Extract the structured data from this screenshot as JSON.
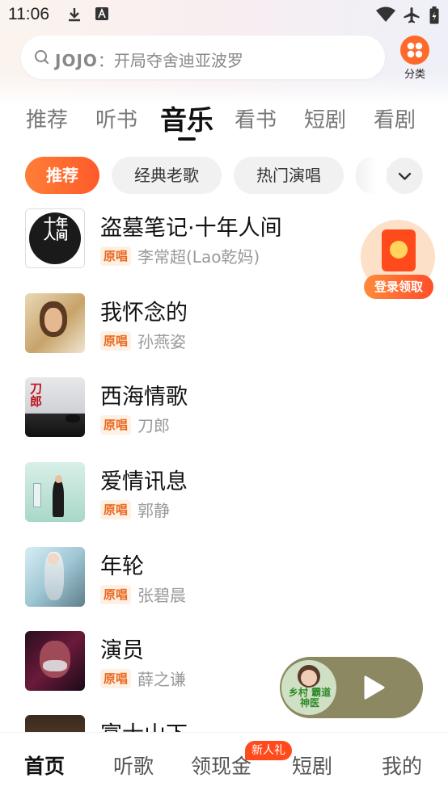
{
  "status_bar": {
    "time": "11:06"
  },
  "search": {
    "keyword": "JOJO",
    "separator": "：",
    "text": "开局夺舍迪亚波罗"
  },
  "category": {
    "label": "分类"
  },
  "tabs": [
    {
      "label": "推荐"
    },
    {
      "label": "听书"
    },
    {
      "label": "音乐",
      "active": true
    },
    {
      "label": "看书"
    },
    {
      "label": "短剧"
    },
    {
      "label": "看剧"
    }
  ],
  "chips": [
    {
      "label": "推荐",
      "active": true
    },
    {
      "label": "经典老歌"
    },
    {
      "label": "热门演唱"
    }
  ],
  "songs": [
    {
      "title": "盗墓笔记·十年人间",
      "badge": "原唱",
      "artist": "李常超(Lao乾妈)",
      "cover_text": "十年人间"
    },
    {
      "title": "我怀念的",
      "badge": "原唱",
      "artist": "孙燕姿"
    },
    {
      "title": "西海情歌",
      "badge": "原唱",
      "artist": "刀郎",
      "cover_text": "刀郎"
    },
    {
      "title": "爱情讯息",
      "badge": "原唱",
      "artist": "郭静"
    },
    {
      "title": "年轮",
      "badge": "原唱",
      "artist": "张碧晨"
    },
    {
      "title": "演员",
      "badge": "原唱",
      "artist": "薛之谦"
    },
    {
      "title": "富士山下"
    }
  ],
  "red_packet": {
    "label": "登录领取"
  },
  "mini_player": {
    "cover_text": "乡村 霸道神医"
  },
  "bottom_nav": [
    {
      "label": "首页",
      "active": true
    },
    {
      "label": "听歌"
    },
    {
      "label": "领现金"
    },
    {
      "label": "短剧"
    },
    {
      "label": "我的"
    }
  ],
  "bottom_nav_badge": "新人礼",
  "colors": {
    "accent": "#ff6a2b",
    "badge_bg": "#fff0e4",
    "badge_text": "#e8681e",
    "player_bg": "#8c8862"
  }
}
